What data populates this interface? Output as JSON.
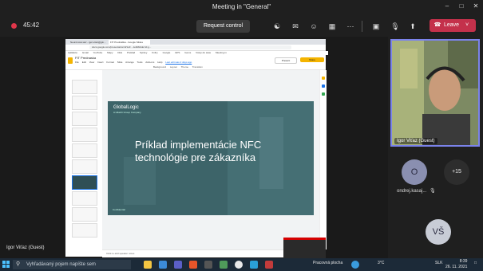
{
  "window": {
    "title": "Meeting in \"General\""
  },
  "toolbar": {
    "timer": "45:42",
    "request_control": "Request control",
    "leave": "Leave",
    "icons": [
      "people-icon",
      "chat-icon",
      "reactions-icon",
      "rooms-icon",
      "share-icon",
      "more-icon",
      "camera-off-icon",
      "mic-off-icon",
      "share-tray-icon"
    ]
  },
  "browser": {
    "tabs": [
      "Neurónová sieť - igor.vitaz@glo...",
      "FIT Prednáška - Google Slides"
    ],
    "url": "docs.google.com/presentation/d/1e9 .../edit#slide=id.g...",
    "bookmarks": [
      "Aplikácie",
      "Gmail",
      "YouTube",
      "Mapy",
      "Disk",
      "Preklad",
      "Správy",
      "Knihy",
      "Google",
      "GPS",
      "Gems",
      "Vstup do siete",
      "Meeting in"
    ],
    "doc_title": "FIT Prednaska",
    "menu": [
      "File",
      "Edit",
      "View",
      "Insert",
      "Format",
      "Slide",
      "Arrange",
      "Tools",
      "Add-ons",
      "Help",
      "Last edit was 2 days ago"
    ],
    "present": "Present",
    "share": "Share",
    "tools": [
      "Background",
      "Layout",
      "Theme",
      "Transition"
    ],
    "speaker_notes": "Click to add speaker notes"
  },
  "slide": {
    "brand": "GlobalLogic",
    "brand_sub": "A Hitachi Group Company",
    "headline": "Príklad implementácie NFC technológie pre zákazníka",
    "footer": "Confidential"
  },
  "participants": {
    "presenter_label": "Igor Viťaz (Guest)",
    "self_label": "Igor Viťaz (Guest)",
    "o_initial": "O",
    "o_name": "ondrej.kasaj...",
    "more": "+15",
    "vs_initials": "VŠ"
  },
  "taskbar": {
    "search_placeholder": "Vyhľadávaný pojem napíšte sem",
    "desktop": "Pracovná plocha",
    "temperature": "3°C",
    "language": "SLK",
    "time": "8:39",
    "date": "26. 11. 2021"
  },
  "colors": {
    "leave": "#c4314b",
    "slide_bg": "#3d6469",
    "self_border": "#7b83eb",
    "taskbar": "#1c2a38"
  }
}
